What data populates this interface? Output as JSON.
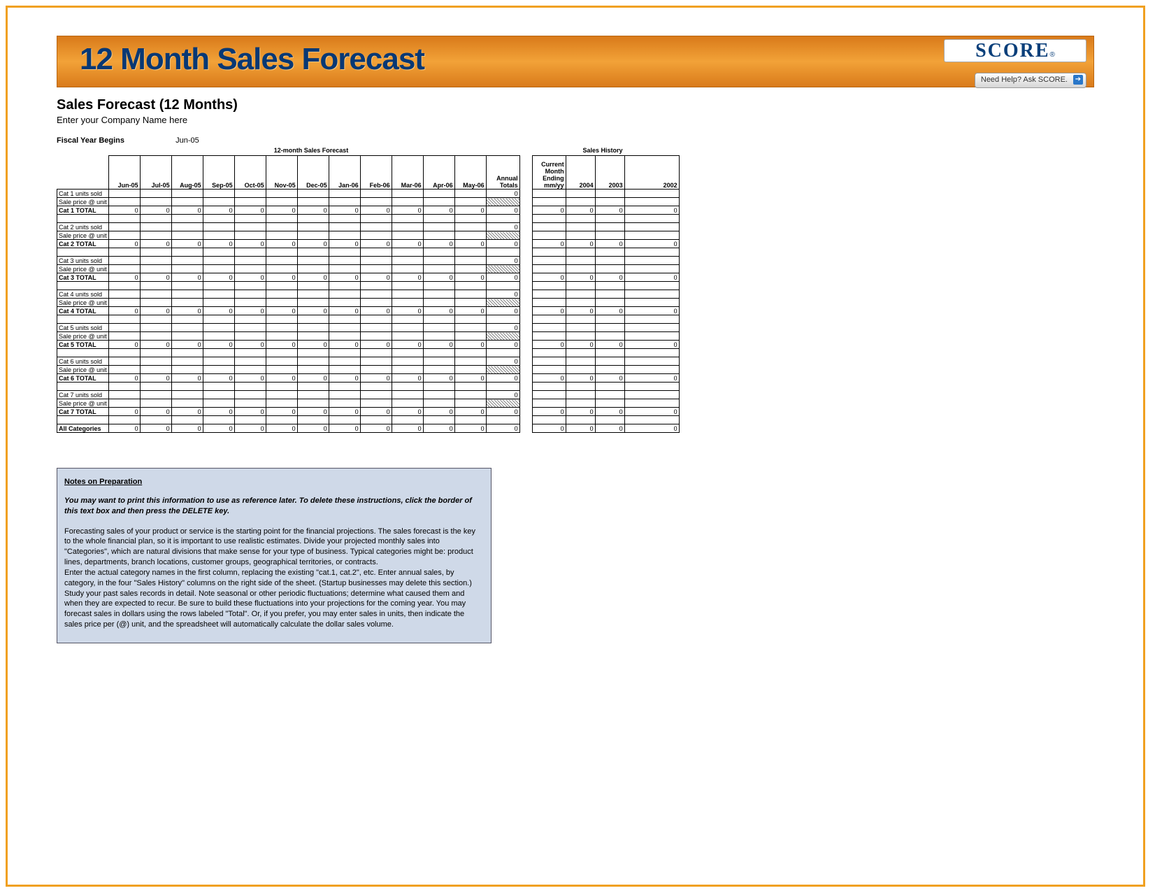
{
  "banner": {
    "title": "12 Month Sales Forecast",
    "score_logo": "SCORE",
    "score_mark": "®",
    "help_label": "Need Help? Ask SCORE."
  },
  "header": {
    "subtitle": "Sales Forecast (12 Months)",
    "company_placeholder": "Enter your Company Name here",
    "fy_label": "Fiscal Year Begins",
    "fy_value": "Jun-05"
  },
  "table_sections": {
    "forecast_title": "12-month Sales Forecast",
    "history_title": "Sales History"
  },
  "columns": {
    "months": [
      "Jun-05",
      "Jul-05",
      "Aug-05",
      "Sep-05",
      "Oct-05",
      "Nov-05",
      "Dec-05",
      "Jan-06",
      "Feb-06",
      "Mar-06",
      "Apr-06",
      "May-06"
    ],
    "annual_header": "Annual Totals",
    "current_header": "Current Month Ending mm/yy",
    "history_years": [
      "2004",
      "2003",
      "2002"
    ]
  },
  "row_labels": {
    "units": "units sold",
    "price": "Sale price @ unit",
    "total": "TOTAL",
    "all_cat": "All Categories"
  },
  "categories": [
    {
      "name": "Cat 1",
      "annual_units": "0",
      "totals": [
        "0",
        "0",
        "0",
        "0",
        "0",
        "0",
        "0",
        "0",
        "0",
        "0",
        "0",
        "0",
        "0"
      ],
      "history": [
        "0",
        "0",
        "0",
        "0"
      ]
    },
    {
      "name": "Cat 2",
      "annual_units": "0",
      "totals": [
        "0",
        "0",
        "0",
        "0",
        "0",
        "0",
        "0",
        "0",
        "0",
        "0",
        "0",
        "0",
        "0"
      ],
      "history": [
        "0",
        "0",
        "0",
        "0"
      ]
    },
    {
      "name": "Cat 3",
      "annual_units": "0",
      "totals": [
        "0",
        "0",
        "0",
        "0",
        "0",
        "0",
        "0",
        "0",
        "0",
        "0",
        "0",
        "0",
        "0"
      ],
      "history": [
        "0",
        "0",
        "0",
        "0"
      ]
    },
    {
      "name": "Cat 4",
      "annual_units": "0",
      "totals": [
        "0",
        "0",
        "0",
        "0",
        "0",
        "0",
        "0",
        "0",
        "0",
        "0",
        "0",
        "0",
        "0"
      ],
      "history": [
        "0",
        "0",
        "0",
        "0"
      ]
    },
    {
      "name": "Cat 5",
      "annual_units": "0",
      "totals": [
        "0",
        "0",
        "0",
        "0",
        "0",
        "0",
        "0",
        "0",
        "0",
        "0",
        "0",
        "0",
        "0"
      ],
      "history": [
        "0",
        "0",
        "0",
        "0"
      ]
    },
    {
      "name": "Cat 6",
      "annual_units": "0",
      "totals": [
        "0",
        "0",
        "0",
        "0",
        "0",
        "0",
        "0",
        "0",
        "0",
        "0",
        "0",
        "0",
        "0"
      ],
      "history": [
        "0",
        "0",
        "0",
        "0"
      ]
    },
    {
      "name": "Cat 7",
      "annual_units": "0",
      "totals": [
        "0",
        "0",
        "0",
        "0",
        "0",
        "0",
        "0",
        "0",
        "0",
        "0",
        "0",
        "0",
        "0"
      ],
      "history": [
        "0",
        "0",
        "0",
        "0"
      ]
    }
  ],
  "all_totals": {
    "months": [
      "0",
      "0",
      "0",
      "0",
      "0",
      "0",
      "0",
      "0",
      "0",
      "0",
      "0",
      "0",
      "0"
    ],
    "history": [
      "0",
      "0",
      "0",
      "0"
    ]
  },
  "notes": {
    "title": "Notes on Preparation",
    "emph": "You may want to print this information to use as reference later. To delete these instructions, click the border of this text box and then press the DELETE key.",
    "p1": "Forecasting sales of your product or service is the starting point for the financial projections. The sales forecast is the key to the whole financial plan, so it is important to use realistic estimates. Divide your projected monthly sales into \"Categories\", which are natural divisions that make sense for your type of business. Typical categories might be: product lines, departments, branch locations, customer groups, geographical territories, or contracts.",
    "p2": "Enter the actual category names in the first column, replacing the existing \"cat.1, cat.2\", etc. Enter annual sales, by category, in the four \"Sales History\" columns on the right side of the sheet. (Startup businesses may delete this section.) Study your past sales records in detail. Note seasonal or other periodic fluctuations; determine what caused them and when they are expected to recur. Be sure to build these fluctuations into your projections for the coming year. You may forecast sales in dollars using the rows labeled \"Total\".  Or, if you prefer, you may enter sales in units, then indicate the sales price per (@) unit, and the spreadsheet will automatically calculate the dollar sales volume."
  }
}
